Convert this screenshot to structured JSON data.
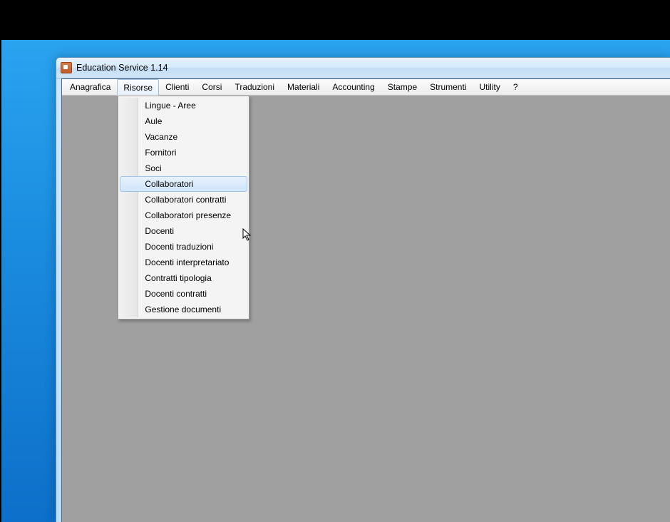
{
  "window": {
    "title": "Education Service 1.14"
  },
  "menubar": {
    "items": [
      {
        "label": "Anagrafica"
      },
      {
        "label": "Risorse",
        "open": true
      },
      {
        "label": "Clienti"
      },
      {
        "label": "Corsi"
      },
      {
        "label": "Traduzioni"
      },
      {
        "label": "Materiali"
      },
      {
        "label": "Accounting"
      },
      {
        "label": "Stampe"
      },
      {
        "label": "Strumenti"
      },
      {
        "label": "Utility"
      },
      {
        "label": "?"
      }
    ]
  },
  "dropdown": {
    "items": [
      {
        "label": "Lingue - Aree"
      },
      {
        "label": "Aule"
      },
      {
        "label": "Vacanze"
      },
      {
        "label": "Fornitori"
      },
      {
        "label": "Soci"
      },
      {
        "label": "Collaboratori",
        "highlight": true
      },
      {
        "label": "Collaboratori contratti"
      },
      {
        "label": "Collaboratori presenze"
      },
      {
        "label": "Docenti"
      },
      {
        "label": "Docenti traduzioni"
      },
      {
        "label": "Docenti interpretariato"
      },
      {
        "label": "Contratti tipologia"
      },
      {
        "label": "Docenti contratti"
      },
      {
        "label": "Gestione documenti"
      }
    ]
  }
}
